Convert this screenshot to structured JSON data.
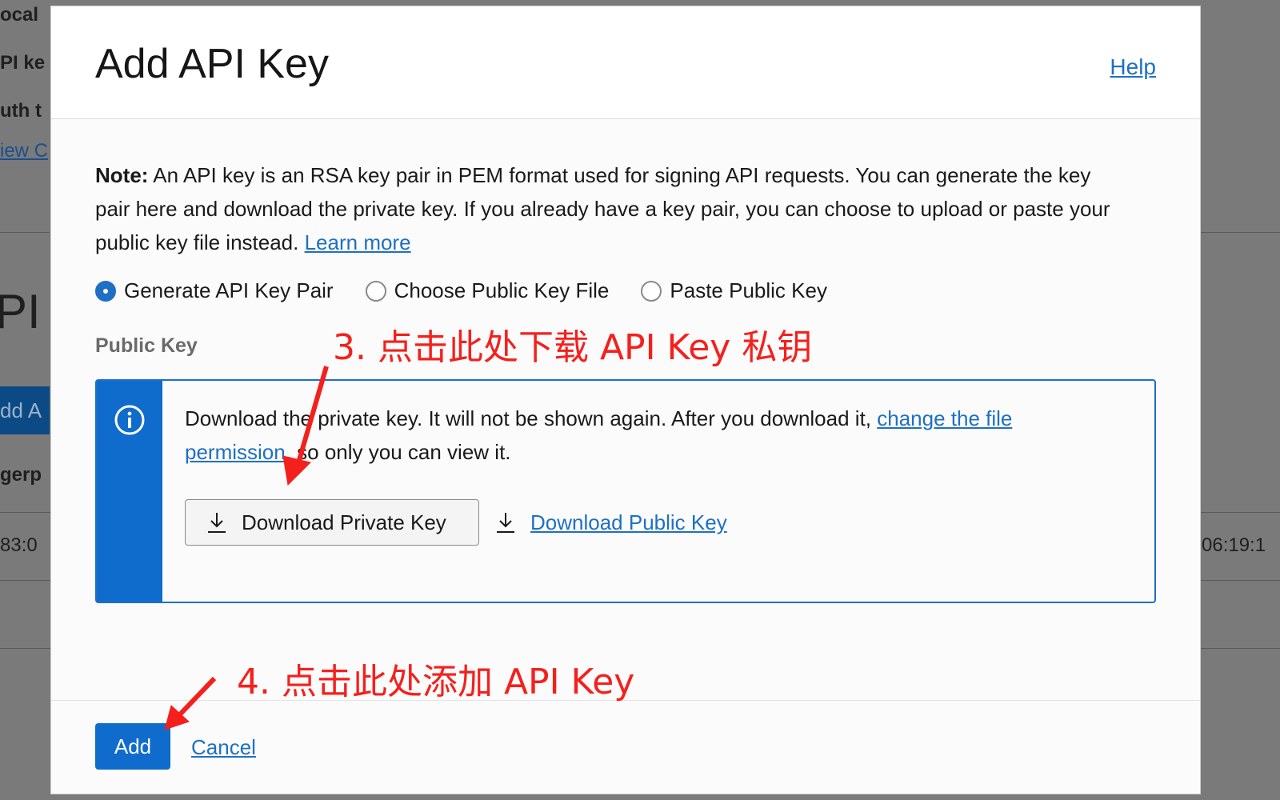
{
  "background": {
    "fragments": [
      "ocal",
      "PI ke",
      "uth t",
      "iew C",
      "PI K",
      "dd A",
      "gerp",
      "83:0",
      "06:19:1"
    ]
  },
  "dialog": {
    "title": "Add API Key",
    "help_label": "Help",
    "note_bold": "Note:",
    "note_text": " An API key is an RSA key pair in PEM format used for signing API requests. You can generate the key pair here and download the private key. If you already have a key pair, you can choose to upload or paste your public key file instead. ",
    "learn_more": "Learn more",
    "radio_options": [
      {
        "label": "Generate API Key Pair",
        "checked": true
      },
      {
        "label": "Choose Public Key File",
        "checked": false
      },
      {
        "label": "Paste Public Key",
        "checked": false
      }
    ],
    "public_key_label": "Public Key",
    "info": {
      "text_before": "Download the private key. It will not be shown again. After you download it, ",
      "link": "change the file permission",
      "text_after": ", so only you can view it.",
      "download_private": "Download Private Key",
      "download_public": "Download Public Key"
    },
    "footer": {
      "add_label": "Add",
      "cancel_label": "Cancel"
    }
  },
  "annotations": {
    "step3": "3. 点击此处下载 API Key 私钥",
    "step4": "4. 点击此处添加 API Key",
    "color": "#f4201c"
  },
  "colors": {
    "accent": "#1f6fc5",
    "info_stripe": "#0f6ccc",
    "button_primary": "#0f6ccc"
  }
}
